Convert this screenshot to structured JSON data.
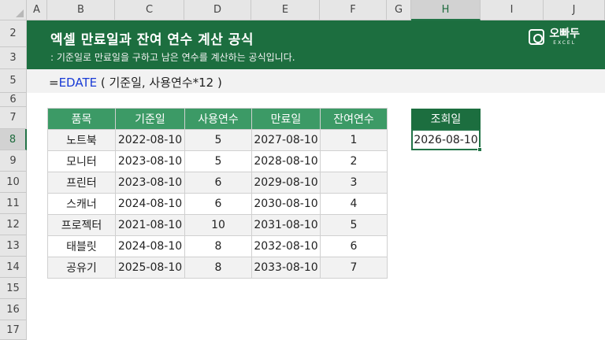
{
  "columns": [
    "A",
    "B",
    "C",
    "D",
    "E",
    "F",
    "G",
    "H",
    "I",
    "J"
  ],
  "active_column": "H",
  "rows": [
    "2",
    "3",
    "5",
    "6",
    "7",
    "8",
    "9",
    "10",
    "11",
    "12",
    "13",
    "14",
    "15",
    "16",
    "17"
  ],
  "active_row": "8",
  "banner": {
    "title": "엑셀 만료일과 잔여 연수 계산 공식",
    "subtitle": ": 기준일로 만료일을 구하고 남은 연수를 계산하는 공식입니다.",
    "brand_name": "오빠두",
    "brand_sub": "EXCEL"
  },
  "formula": {
    "prefix": "=",
    "function": "EDATE",
    "args": " ( 기준일, 사용연수*12 )"
  },
  "table": {
    "headers": [
      "품목",
      "기준일",
      "사용연수",
      "만료일",
      "잔여연수"
    ],
    "rows": [
      [
        "노트북",
        "2022-08-10",
        "5",
        "2027-08-10",
        "1"
      ],
      [
        "모니터",
        "2023-08-10",
        "5",
        "2028-08-10",
        "2"
      ],
      [
        "프린터",
        "2023-08-10",
        "6",
        "2029-08-10",
        "3"
      ],
      [
        "스캐너",
        "2024-08-10",
        "6",
        "2030-08-10",
        "4"
      ],
      [
        "프로젝터",
        "2021-08-10",
        "10",
        "2031-08-10",
        "5"
      ],
      [
        "태블릿",
        "2024-08-10",
        "8",
        "2032-08-10",
        "6"
      ],
      [
        "공유기",
        "2025-08-10",
        "8",
        "2033-08-10",
        "7"
      ]
    ]
  },
  "lookup": {
    "header": "조회일",
    "value": "2026-08-10"
  },
  "colors": {
    "banner": "#1c6e3f",
    "table_header": "#3c9a66",
    "function_text": "#1a3cd6",
    "selection": "#217346"
  }
}
